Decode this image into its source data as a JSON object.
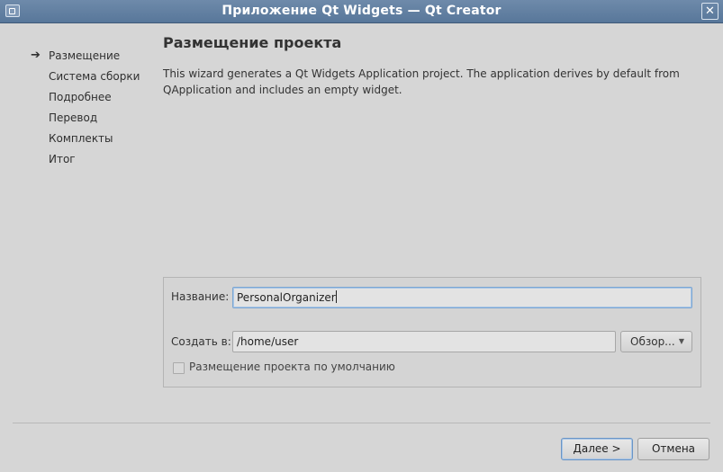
{
  "window": {
    "title": "Приложение Qt Widgets — Qt Creator",
    "icon": "app-window-icon",
    "close_icon": "close-icon",
    "close_glyph": "✕"
  },
  "steps": {
    "items": [
      {
        "label": "Размещение",
        "current": true
      },
      {
        "label": "Система сборки",
        "current": false
      },
      {
        "label": "Подробнее",
        "current": false
      },
      {
        "label": "Перевод",
        "current": false
      },
      {
        "label": "Комплекты",
        "current": false
      },
      {
        "label": "Итог",
        "current": false
      }
    ],
    "current_marker": "➔"
  },
  "page": {
    "title": "Размещение проекта",
    "description": "This wizard generates a Qt Widgets Application project. The application derives by default from QApplication and includes an empty widget."
  },
  "form": {
    "name_label": "Название:",
    "name_value": "PersonalOrganizer",
    "create_in_label": "Создать в:",
    "create_in_value": "/home/user",
    "browse_label": "Обзор...",
    "browse_chevron": "▼",
    "default_location_label": "Размещение проекта по умолчанию",
    "default_location_checked": false
  },
  "buttons": {
    "next_label": "Далее >",
    "cancel_label": "Отмена"
  },
  "colors": {
    "titlebar": "#58779a",
    "background": "#d6d6d6",
    "focus_accent": "#6a95c6"
  }
}
